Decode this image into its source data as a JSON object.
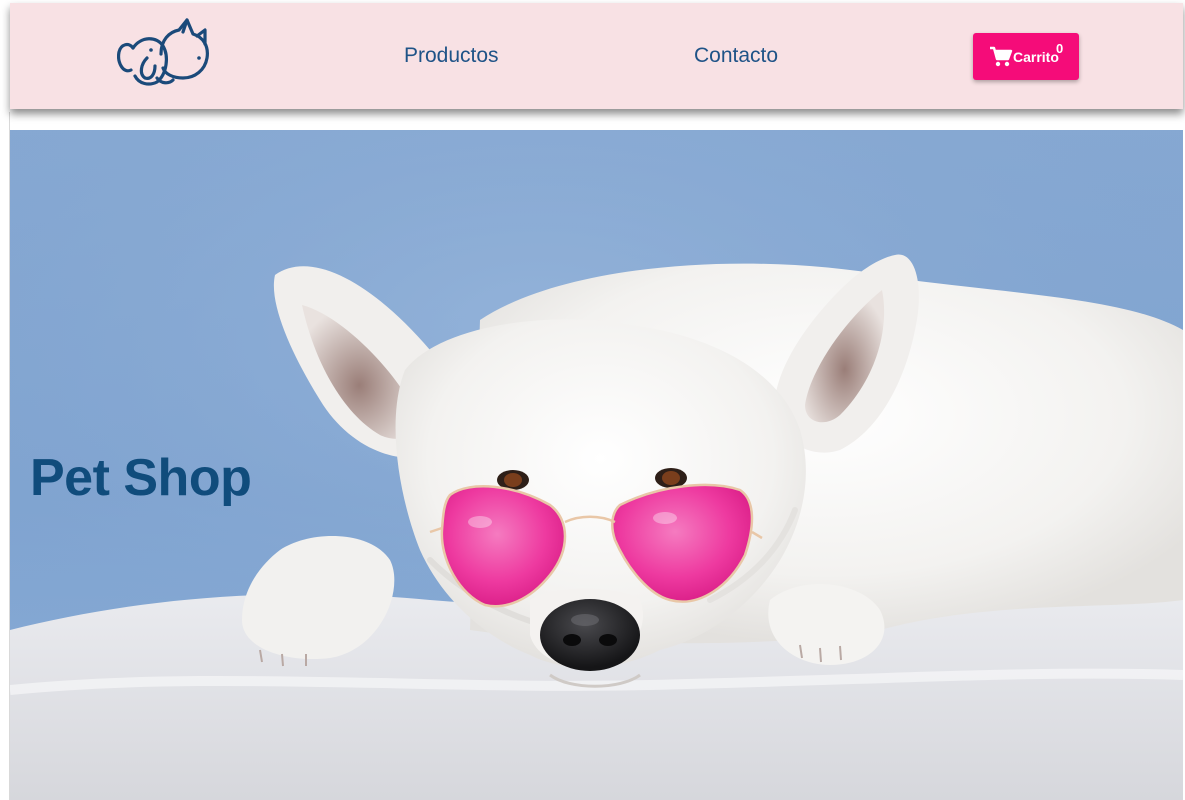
{
  "nav": {
    "logo_icon": "dog-and-cat-logo-icon",
    "links": [
      {
        "label": "Productos"
      },
      {
        "label": "Contacto"
      }
    ],
    "cart": {
      "icon": "shopping-cart-icon",
      "label": "Carrito",
      "count": "0"
    }
  },
  "hero": {
    "title": "Pet Shop",
    "image": "white dog wearing pink heart-shaped sunglasses lying on a white blanket, blue background"
  },
  "colors": {
    "navbar_bg": "#f8e1e4",
    "link": "#1f5387",
    "cart_button": "#f50c79",
    "hero_title": "#104c7c",
    "hero_wall": "#86a8d2",
    "sunglasses": "#f0359e"
  }
}
